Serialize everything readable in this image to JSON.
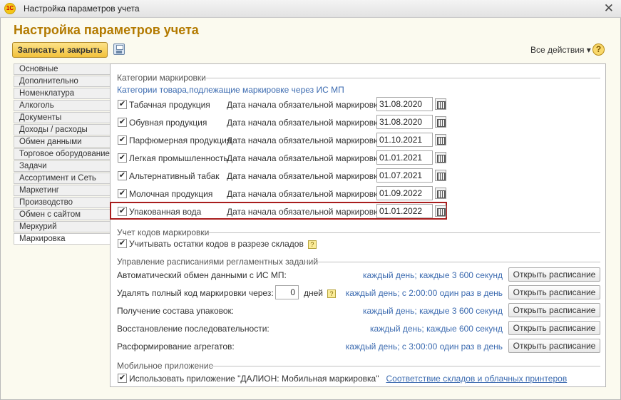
{
  "window": {
    "title": "Настройка параметров учета",
    "close": "✕",
    "logo": "1С"
  },
  "form": {
    "title": "Настройка параметров учета",
    "save_close": "Записать и закрыть",
    "all_actions": "Все действия ▾",
    "help": "?"
  },
  "nav": [
    "Основные",
    "Дополнительно",
    "Номенклатура",
    "Алкоголь",
    "Документы",
    "Доходы / расходы",
    "Обмен данными",
    "Торговое оборудование",
    "Задачи",
    "Ассортимент и Сеть",
    "Маркетинг",
    "Производство",
    "Обмен с сайтом",
    "Меркурий",
    "Маркировка"
  ],
  "nav_active": "Маркировка",
  "marking": {
    "section_title": "Категории маркировки",
    "subtitle": "Категории товара,подлежащие маркировке через ИС МП",
    "date_label": "Дата начала обязательной маркировки:",
    "categories": [
      {
        "label": "Табачная продукция",
        "date": "31.08.2020",
        "checked": true
      },
      {
        "label": "Обувная продукция",
        "date": "31.08.2020",
        "checked": true
      },
      {
        "label": "Парфюмерная продукция",
        "date": "01.10.2021",
        "checked": true
      },
      {
        "label": "Легкая промышленность",
        "date": "01.01.2021",
        "checked": true
      },
      {
        "label": "Альтернативный табак",
        "date": "01.07.2021",
        "checked": true
      },
      {
        "label": "Молочная продукция",
        "date": "01.09.2022",
        "checked": true
      },
      {
        "label": "Упакованная вода",
        "date": "01.01.2022",
        "checked": true
      }
    ]
  },
  "codes": {
    "section_title": "Учет кодов маркировки",
    "option": "Учитывать остатки кодов в разрезе складов",
    "help": "?"
  },
  "schedules": {
    "section_title": "Управление расписаниями регламентных заданий",
    "button": "Открыть расписание",
    "rows": [
      {
        "label": "Автоматический обмен данными с ИС МП:",
        "schedule": "каждый день; каждые 3 600 секунд"
      },
      {
        "label": "Удалять полный код маркировки через:",
        "schedule": "каждый день; с 2:00:00 один раз в день",
        "value": "0",
        "unit": "дней"
      },
      {
        "label": "Получение состава упаковок:",
        "schedule": "каждый день; каждые 3 600 секунд"
      },
      {
        "label": "Восстановление последовательности:",
        "schedule": "каждый день; каждые 600 секунд"
      },
      {
        "label": "Расформирование агрегатов:",
        "schedule": "каждый день; с 3:00:00 один раз в день"
      }
    ]
  },
  "mobile": {
    "section_title": "Мобильное приложение",
    "option": "Использовать приложение \"ДАЛИОН: Мобильная маркировка\"",
    "link": "Соответствие складов и облачных принтеров"
  },
  "colors": {
    "accent": "#b37a00",
    "link": "#3c6bb0",
    "highlight": "#a81d1d",
    "button": "#f2c13b"
  }
}
